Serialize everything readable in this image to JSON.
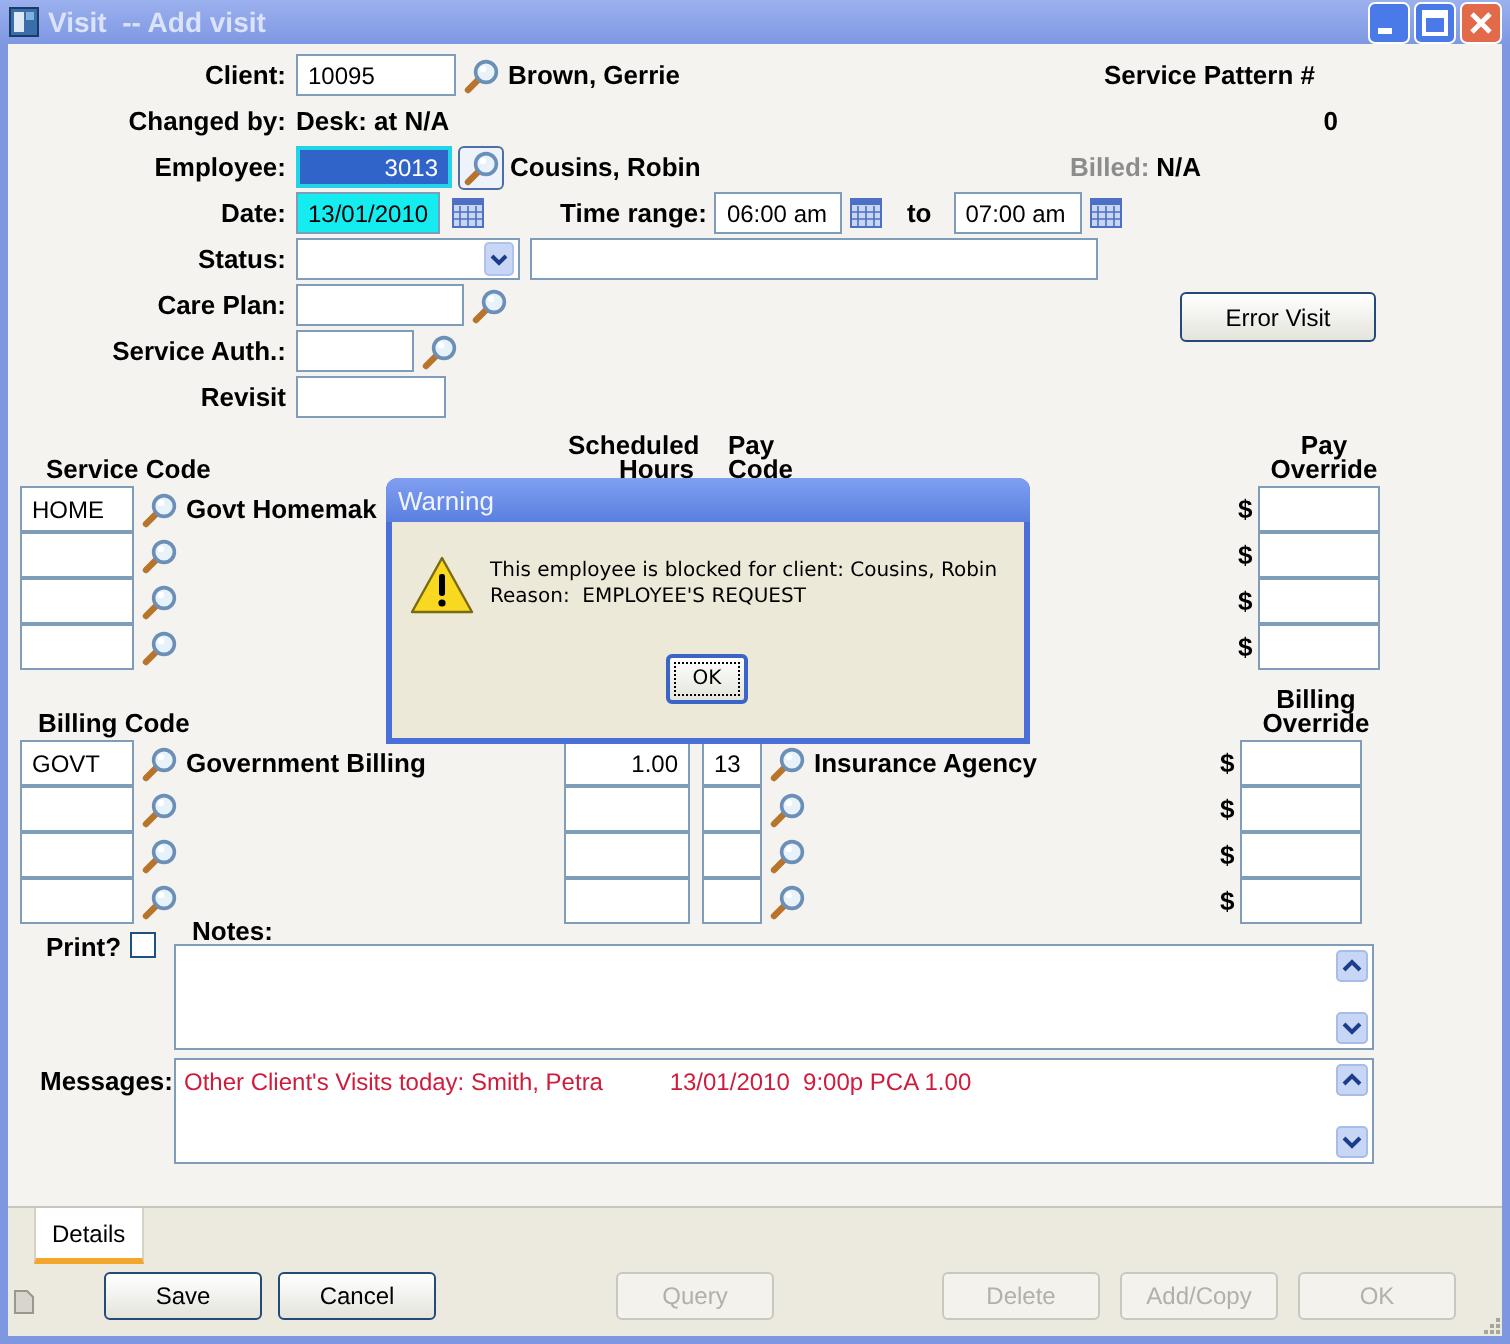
{
  "window": {
    "title": "Visit  -- Add visit"
  },
  "header": {
    "client": {
      "label": "Client:",
      "value": "10095",
      "name": "Brown, Gerrie"
    },
    "changed_by": {
      "label": "Changed by:",
      "value": "Desk: at N/A"
    },
    "employee": {
      "label": "Employee:",
      "value": "3013",
      "name": "Cousins, Robin",
      "focused": true
    },
    "date": {
      "label": "Date:",
      "value": "13/01/2010",
      "highlighted": true
    },
    "time_range": {
      "label": "Time range:",
      "from": "06:00 am",
      "separator": "to",
      "to": "07:00 am"
    },
    "status": {
      "label": "Status:"
    },
    "care_plan": {
      "label": "Care Plan:"
    },
    "service_auth": {
      "label": "Service Auth.:"
    },
    "revisit": {
      "label": "Revisit"
    },
    "service_pattern": {
      "label": "Service Pattern #",
      "value": "0"
    },
    "billed": {
      "label": "Billed:",
      "value": "N/A"
    },
    "error_visit_button": {
      "label": "Error Visit"
    }
  },
  "service": {
    "code_heading": "Service Code",
    "hours_heading": "Scheduled Hours",
    "pay_code_heading": "Pay Code",
    "override_heading": "Pay Override",
    "rows": [
      {
        "code": "HOME",
        "name": "Govt Homemak",
        "currency": "$"
      },
      {
        "currency": "$"
      },
      {
        "currency": "$"
      },
      {
        "currency": "$"
      }
    ]
  },
  "billing": {
    "code_heading": "Billing Code",
    "override_heading": "Billing Override",
    "rows": [
      {
        "code": "GOVT",
        "name": "Government Billing",
        "hours": "1.00",
        "pay_code": "13",
        "agency": "Insurance Agency",
        "currency": "$"
      },
      {
        "currency": "$"
      },
      {
        "currency": "$"
      },
      {
        "currency": "$"
      }
    ]
  },
  "notes": {
    "label": "Notes:",
    "print_label": "Print?",
    "print_checked": false
  },
  "messages": {
    "label": "Messages:",
    "text": "Other Client's Visits today: Smith, Petra          13/01/2010  9:00p PCA 1.00"
  },
  "tabs": [
    {
      "label": "Details",
      "selected": true
    }
  ],
  "buttons": [
    {
      "label": "Save",
      "disabled": false
    },
    {
      "label": "Cancel",
      "disabled": false
    },
    {
      "label": "Query",
      "disabled": true
    },
    {
      "label": "Delete",
      "disabled": true
    },
    {
      "label": "Add/Copy",
      "disabled": true
    },
    {
      "label": "OK",
      "disabled": true
    }
  ],
  "dialog": {
    "title": "Warning",
    "lines": [
      "This employee is blocked for client: Cousins, Robin",
      "Reason:  EMPLOYEE'S REQUEST"
    ],
    "button": "OK"
  }
}
